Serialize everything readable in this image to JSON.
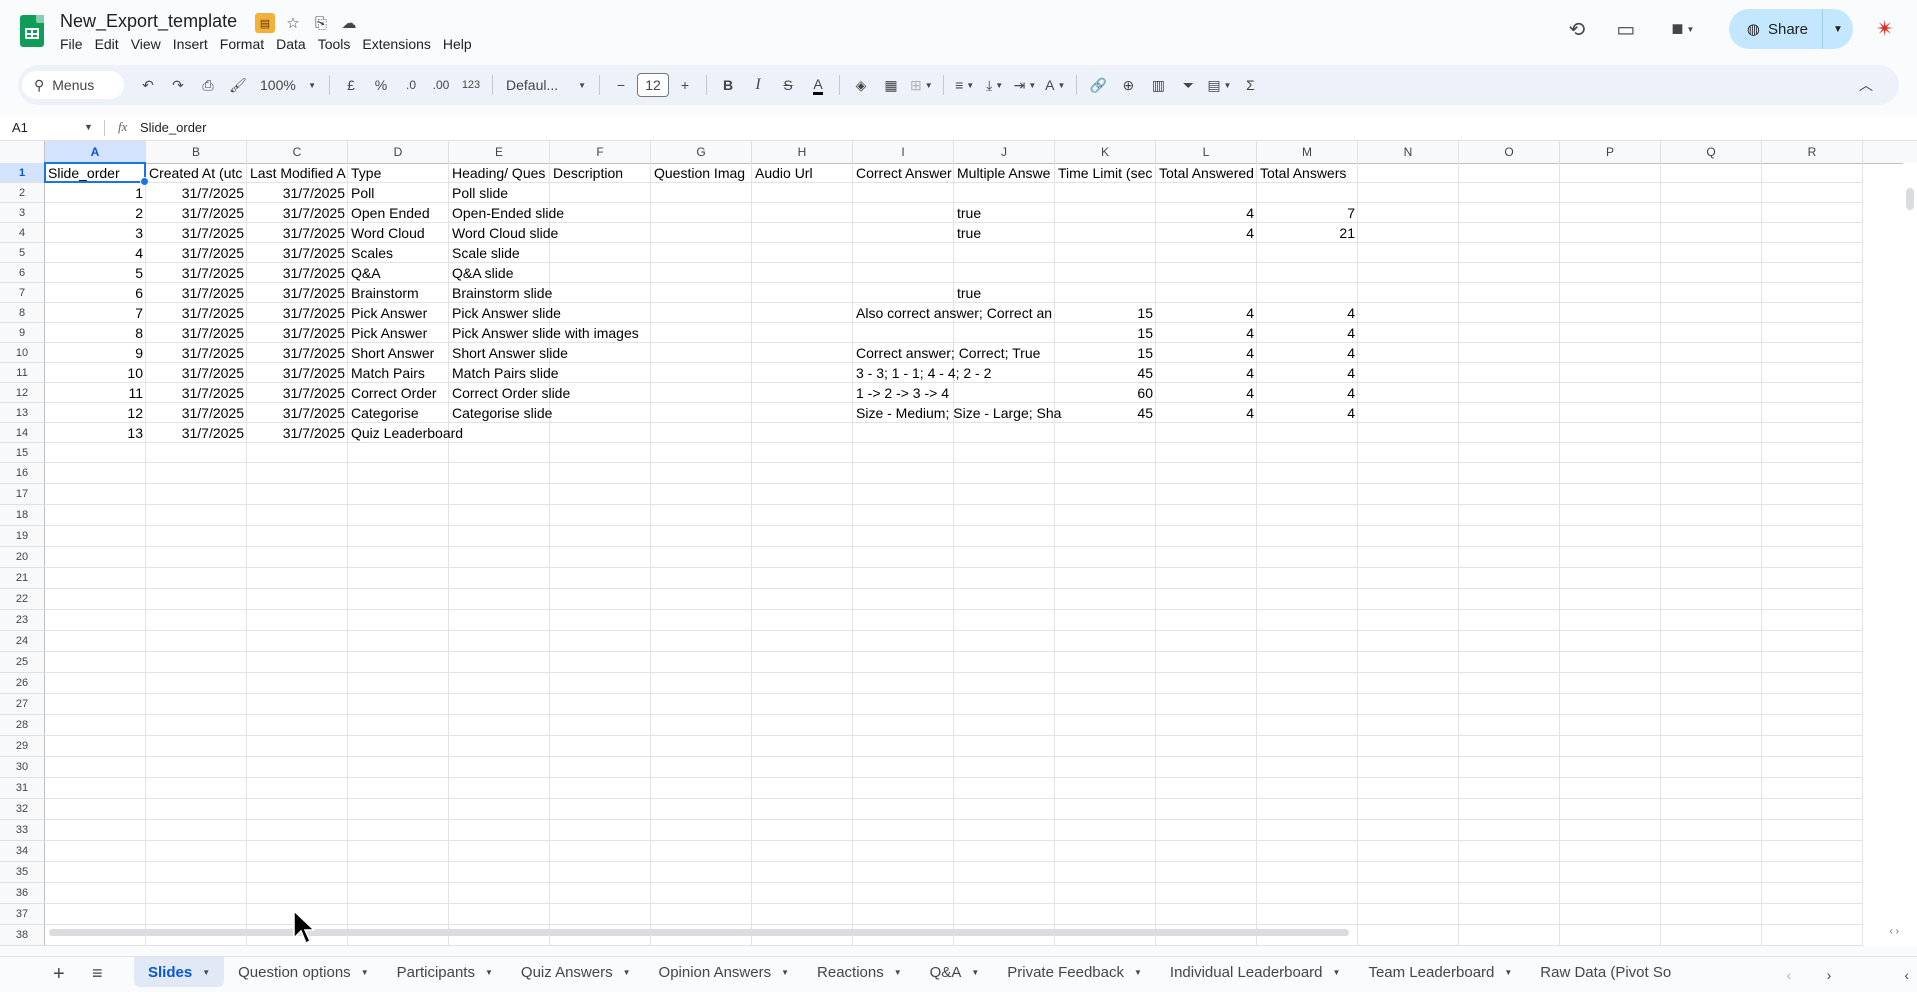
{
  "app": {
    "doc_title": "New_Export_template",
    "menus": [
      "File",
      "Edit",
      "View",
      "Insert",
      "Format",
      "Data",
      "Tools",
      "Extensions",
      "Help"
    ],
    "share_label": "Share"
  },
  "toolbar": {
    "menus_label": "Menus",
    "zoom": "100%",
    "currency": "£",
    "percent": "%",
    "dec_decrease": ".0",
    "dec_increase": ".00",
    "number_format": "123",
    "font": "Defaul...",
    "font_size": "12",
    "bold": "B",
    "italic": "I",
    "strike": "S",
    "text_color": "A",
    "sum": "Σ"
  },
  "formula_bar": {
    "name_box": "A1",
    "fx": "fx",
    "content": "Slide_order"
  },
  "grid": {
    "columns": [
      "A",
      "B",
      "C",
      "D",
      "E",
      "F",
      "G",
      "H",
      "I",
      "J",
      "K",
      "L",
      "M",
      "N",
      "O",
      "P",
      "Q",
      "R"
    ],
    "row_numbers": [
      "1",
      "2",
      "3",
      "4",
      "5",
      "6",
      "7",
      "8",
      "9",
      "10",
      "11",
      "12",
      "13",
      "14",
      "15",
      "16",
      "17",
      "18",
      "19",
      "20",
      "21",
      "22",
      "23",
      "24",
      "25",
      "26",
      "27",
      "28",
      "29",
      "30",
      "31",
      "32",
      "33",
      "34",
      "35",
      "36",
      "37",
      "38"
    ],
    "header_row": [
      "Slide_order",
      "Created At (utc",
      "Last Modified A",
      "Type",
      "Heading/ Ques",
      "Description",
      "Question Imag",
      "Audio Url",
      "Correct Answer",
      "Multiple Answe",
      "Time Limit (sec",
      "Total Answered",
      "Total Answers"
    ],
    "rows": [
      [
        "1",
        "31/7/2025",
        "31/7/2025",
        "Poll",
        "Poll slide",
        "",
        "",
        "",
        "",
        "",
        "",
        "",
        ""
      ],
      [
        "2",
        "31/7/2025",
        "31/7/2025",
        "Open Ended",
        "Open-Ended slide",
        "",
        "",
        "",
        "",
        "true",
        "",
        "4",
        "7"
      ],
      [
        "3",
        "31/7/2025",
        "31/7/2025",
        "Word Cloud",
        "Word Cloud slide",
        "",
        "",
        "",
        "",
        "true",
        "",
        "4",
        "21"
      ],
      [
        "4",
        "31/7/2025",
        "31/7/2025",
        "Scales",
        "Scale slide",
        "",
        "",
        "",
        "",
        "",
        "",
        "",
        ""
      ],
      [
        "5",
        "31/7/2025",
        "31/7/2025",
        "Q&A",
        "Q&A slide",
        "",
        "",
        "",
        "",
        "",
        "",
        "",
        ""
      ],
      [
        "6",
        "31/7/2025",
        "31/7/2025",
        "Brainstorm",
        "Brainstorm slide",
        "",
        "",
        "",
        "",
        "true",
        "",
        "",
        ""
      ],
      [
        "7",
        "31/7/2025",
        "31/7/2025",
        "Pick Answer",
        "Pick Answer slide",
        "",
        "",
        "",
        "Also correct answer; Correct an",
        "",
        "15",
        "4",
        "4"
      ],
      [
        "8",
        "31/7/2025",
        "31/7/2025",
        "Pick Answer",
        "Pick Answer slide with images",
        "",
        "",
        "",
        "",
        "",
        "15",
        "4",
        "4"
      ],
      [
        "9",
        "31/7/2025",
        "31/7/2025",
        "Short Answer",
        "Short Answer slide",
        "",
        "",
        "",
        "Correct answer; Correct; True",
        "",
        "15",
        "4",
        "4"
      ],
      [
        "10",
        "31/7/2025",
        "31/7/2025",
        "Match Pairs",
        "Match Pairs slide",
        "",
        "",
        "",
        "3 - 3; 1 - 1; 4 - 4; 2 - 2",
        "",
        "45",
        "4",
        "4"
      ],
      [
        "11",
        "31/7/2025",
        "31/7/2025",
        "Correct Order",
        "Correct Order slide",
        "",
        "",
        "",
        "1 -> 2 -> 3 -> 4",
        "",
        "60",
        "4",
        "4"
      ],
      [
        "12",
        "31/7/2025",
        "31/7/2025",
        "Categorise",
        "Categorise slide",
        "",
        "",
        "",
        "Size - Medium; Size - Large; Sha",
        "",
        "45",
        "4",
        "4"
      ],
      [
        "13",
        "31/7/2025",
        "31/7/2025",
        "Quiz Leaderboard",
        "",
        "",
        "",
        "",
        "",
        "",
        "",
        "",
        ""
      ]
    ]
  },
  "sheet_tabs": [
    "Slides",
    "Question options",
    "Participants",
    "Quiz Answers",
    "Opinion Answers",
    "Reactions",
    "Q&A",
    "Private Feedback",
    "Individual Leaderboard",
    "Team Leaderboard",
    "Raw Data (Pivot So"
  ],
  "active_tab": "Slides",
  "icons": {
    "accent": "#0b57d0",
    "share_bg": "#c2e7ff",
    "sheets_green": "#0f9d58"
  }
}
